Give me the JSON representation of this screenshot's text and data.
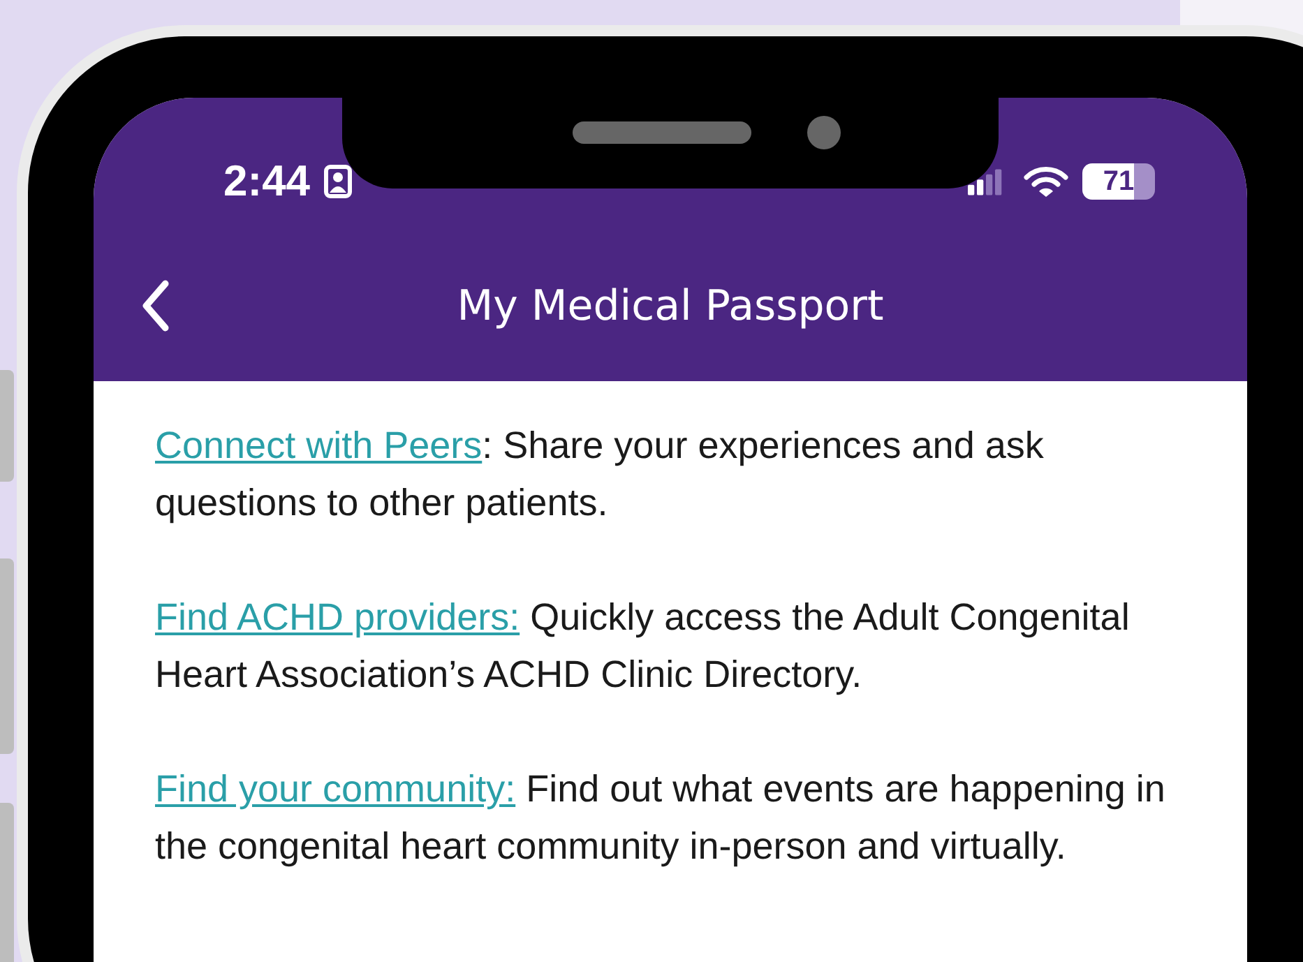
{
  "status_bar": {
    "time": "2:44",
    "battery": "71"
  },
  "nav": {
    "title": "My Medical Passport"
  },
  "items": [
    {
      "link": "Connect with Peers",
      "text": ": Share your experiences and ask questions to other patients."
    },
    {
      "link": "Find ACHD providers:",
      "text": " Quickly access the Adult Congenital Heart Association’s ACHD Clinic Directory."
    },
    {
      "link": "Find your community:",
      "text": " Find out what events are happening in the congenital heart community in-person and virtually."
    }
  ]
}
